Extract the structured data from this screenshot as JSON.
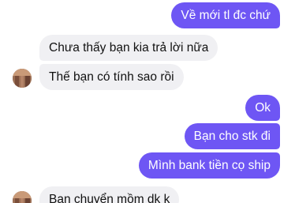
{
  "conversation": {
    "messages": [
      {
        "sender": "me",
        "text": "Về mới tl đc chứ"
      },
      {
        "sender": "them",
        "text": "Chưa thấy bạn kia trả lời nữa"
      },
      {
        "sender": "them",
        "text": "Thế bạn có tính sao rồi"
      },
      {
        "sender": "me",
        "text": "Ok"
      },
      {
        "sender": "me",
        "text": "Bạn cho stk đi"
      },
      {
        "sender": "me",
        "text": "Mình bank tiền cọ ship"
      },
      {
        "sender": "them",
        "text": "Bạn chuyển mồm dk k"
      }
    ]
  },
  "colors": {
    "outgoing_bubble": "#6e56f4",
    "incoming_bubble": "#f0f0f3"
  },
  "icons": {
    "contact_avatar": "contact-avatar"
  }
}
